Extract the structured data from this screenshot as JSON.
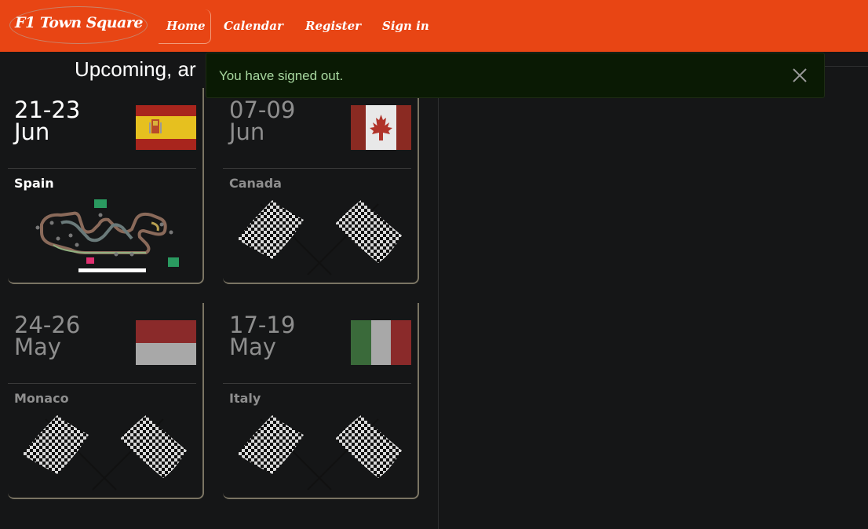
{
  "navbar": {
    "brand": "F1 Town Square",
    "links": [
      "Home",
      "Calendar",
      "Register",
      "Sign in"
    ],
    "bg_color": "#e84514"
  },
  "page": {
    "heading": "Upcoming, ar"
  },
  "alert": {
    "message": "You have signed out.",
    "close_icon": "close-icon"
  },
  "races": [
    {
      "dates": "21-23",
      "month": "Jun",
      "country": "Spain",
      "flag": "spain-flag",
      "image": "circuit-map",
      "dim": false
    },
    {
      "dates": "07-09",
      "month": "Jun",
      "country": "Canada",
      "flag": "canada-flag",
      "image": "checkered-flags",
      "dim": true
    },
    {
      "dates": "24-26",
      "month": "May",
      "country": "Monaco",
      "flag": "monaco-flag",
      "image": "checkered-flags",
      "dim": true
    },
    {
      "dates": "17-19",
      "month": "May",
      "country": "Italy",
      "flag": "italy-flag",
      "image": "checkered-flags",
      "dim": true
    }
  ]
}
